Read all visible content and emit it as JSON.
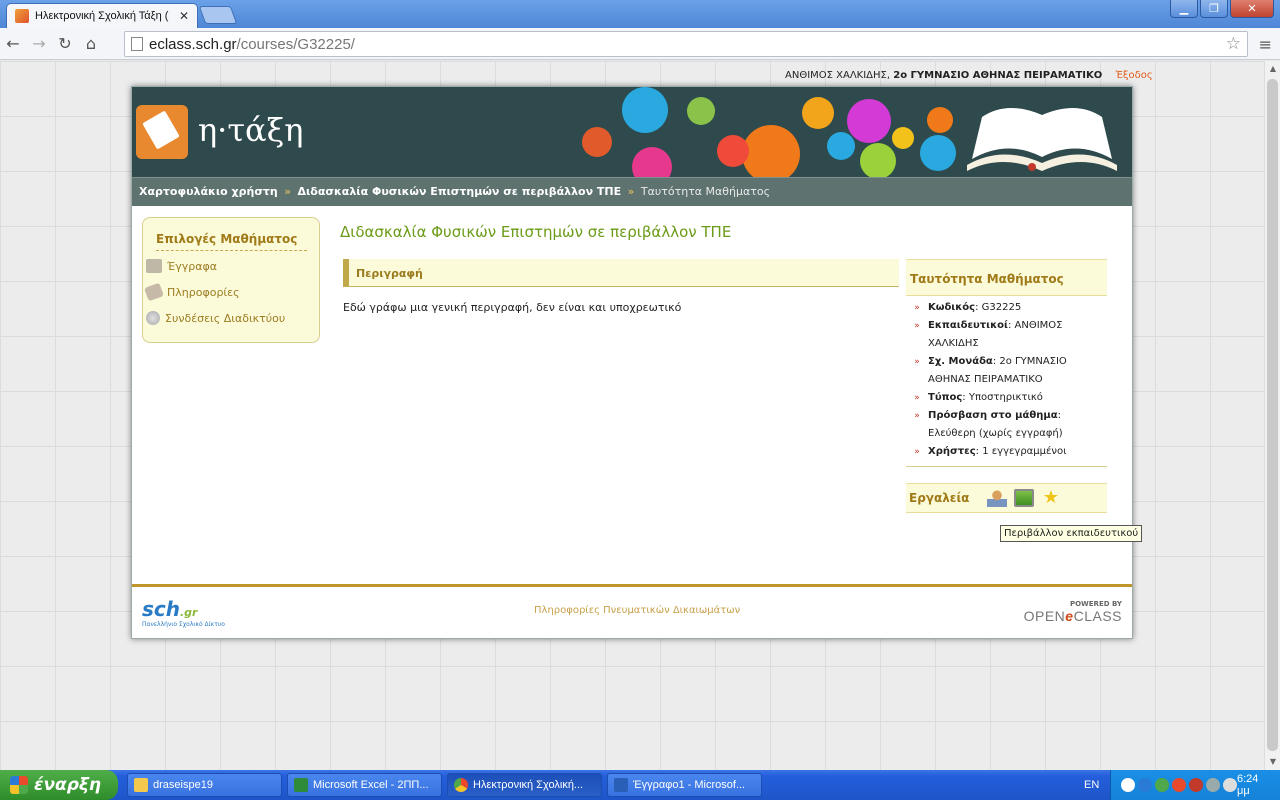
{
  "browser": {
    "tab_title": "Ηλεκτρονική Σχολική Τάξη (",
    "tab_close": "✕",
    "url_host": "eclass.sch.gr",
    "url_path": "/courses/G32225/",
    "win_min": "▁",
    "win_max": "❐",
    "win_close": "✕",
    "back": "←",
    "forward": "→",
    "reload": "↻",
    "home": "⌂",
    "star": "☆",
    "wrench": "≡"
  },
  "userbar": {
    "name": "ΑΝΘΙΜΟΣ ΧΑΛΚΙΔΗΣ,",
    "school": "2ο ΓΥΜΝΑΣΙΟ ΑΘΗΝΑΣ ΠΕΙΡΑΜΑΤΙΚΟ",
    "logout": "Έξοδος"
  },
  "brand": "η·τάξη",
  "breadcrumb": {
    "portfolio": "Χαρτοφυλάκιο χρήστη",
    "course": "Διδασκαλία Φυσικών Επιστημών σε περιβάλλον ΤΠΕ",
    "current": "Ταυτότητα Μαθήματος",
    "sep": "»"
  },
  "sidebar": {
    "title": "Επιλογές Μαθήματος",
    "items": [
      {
        "label": "Έγγραφα",
        "icon": "folder-icon"
      },
      {
        "label": "Πληροφορίες",
        "icon": "tag-icon"
      },
      {
        "label": "Συνδέσεις Διαδικτύου",
        "icon": "globe-icon"
      }
    ]
  },
  "course": {
    "title": "Διδασκαλία Φυσικών Επιστημών σε περιβάλλον ΤΠΕ",
    "desc_header": "Περιγραφή",
    "desc_text": "Εδώ γράφω μια γενική περιγραφή, δεν είναι και υποχρεωτικό"
  },
  "identity": {
    "header": "Ταυτότητα Μαθήματος",
    "bullet": "»",
    "rows": [
      {
        "label": "Κωδικός",
        "value": "G32225"
      },
      {
        "label": "Εκπαιδευτικοί",
        "value": "ΑΝΘΙΜΟΣ ΧΑΛΚΙΔΗΣ"
      },
      {
        "label": "Σχ. Μονάδα",
        "value": "2ο ΓΥΜΝΑΣΙΟ ΑΘΗΝΑΣ ΠΕΙΡΑΜΑΤΙΚΟ"
      },
      {
        "label": "Τύπος",
        "value": "Υποστηρικτικό"
      },
      {
        "label": "Πρόσβαση στο μάθημα",
        "value": "Ελεύθερη (χωρίς εγγραφή)"
      },
      {
        "label": "Χρήστες",
        "value": "1 εγγεγραμμένοι"
      }
    ],
    "tools_label": "Εργαλεία",
    "star": "★",
    "tooltip": "Περιβάλλον εκπαιδευτικού"
  },
  "footer": {
    "sch": "sch",
    "gr": ".gr",
    "sch_sub": "Πανελλήνιο Σχολικό Δίκτυο",
    "link": "Πληροφορίες Πνευματικών Δικαιωμάτων",
    "powered": "POWERED BY",
    "open": "OPEN",
    "e": "e",
    "class": "CLASS"
  },
  "taskbar": {
    "start": "έναρξη",
    "tasks": [
      {
        "label": "draseispe19",
        "icon": "folder-icon"
      },
      {
        "label": "Microsoft Excel - 2ΠΠ...",
        "icon": "excel-icon"
      },
      {
        "label": "Ηλεκτρονική Σχολική...",
        "icon": "chrome-icon"
      },
      {
        "label": "Έγγραφο1 - Microsof...",
        "icon": "word-icon"
      }
    ],
    "lang": "EN",
    "clock": "6:24 μμ"
  },
  "colors": {
    "accent_green": "#6b9b17",
    "gold": "#a17a18",
    "banner": "#2f4a4d",
    "breadcrumb": "#5e7370",
    "logout": "#e25b1b"
  }
}
